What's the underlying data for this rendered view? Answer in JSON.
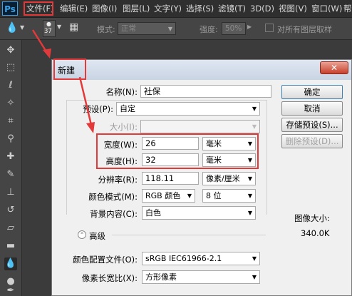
{
  "app": {
    "logo": "Ps"
  },
  "menubar": {
    "items": [
      "文件(F)",
      "编辑(E)",
      "图像(I)",
      "图层(L)",
      "文字(Y)",
      "选择(S)",
      "滤镜(T)",
      "3D(D)",
      "视图(V)",
      "窗口(W)",
      "帮"
    ]
  },
  "options": {
    "brush_size": "37",
    "mode_label": "模式:",
    "mode_value": "正常",
    "strength_label": "强度:",
    "strength_value": "50%",
    "sample_all_label": "对所有图层取样"
  },
  "dialog": {
    "title": "新建",
    "close_glyph": "✕",
    "name_label": "名称(N):",
    "name_value": "社保",
    "preset_label": "预设(P):",
    "preset_value": "自定",
    "size_label": "大小(I):",
    "size_value": "",
    "width_label": "宽度(W):",
    "width_value": "26",
    "width_unit": "毫米",
    "height_label": "高度(H):",
    "height_value": "32",
    "height_unit": "毫米",
    "resolution_label": "分辨率(R):",
    "resolution_value": "118.11",
    "resolution_unit": "像素/厘米",
    "color_mode_label": "颜色模式(M):",
    "color_mode_value": "RGB 颜色",
    "bit_depth_value": "8 位",
    "background_label": "背景内容(C):",
    "background_value": "白色",
    "advanced_label": "高级",
    "color_profile_label": "颜色配置文件(O):",
    "color_profile_value": "sRGB IEC61966-2.1",
    "pixel_aspect_label": "像素长宽比(X):",
    "pixel_aspect_value": "方形像素",
    "ok_label": "确定",
    "cancel_label": "取消",
    "save_preset_label": "存储预设(S)...",
    "delete_preset_label": "删除预设(D)...",
    "image_size_label": "图像大小:",
    "image_size_value": "340.0K"
  },
  "colors": {
    "annotation": "#e23a3a",
    "accent": "#3aa0e8"
  }
}
